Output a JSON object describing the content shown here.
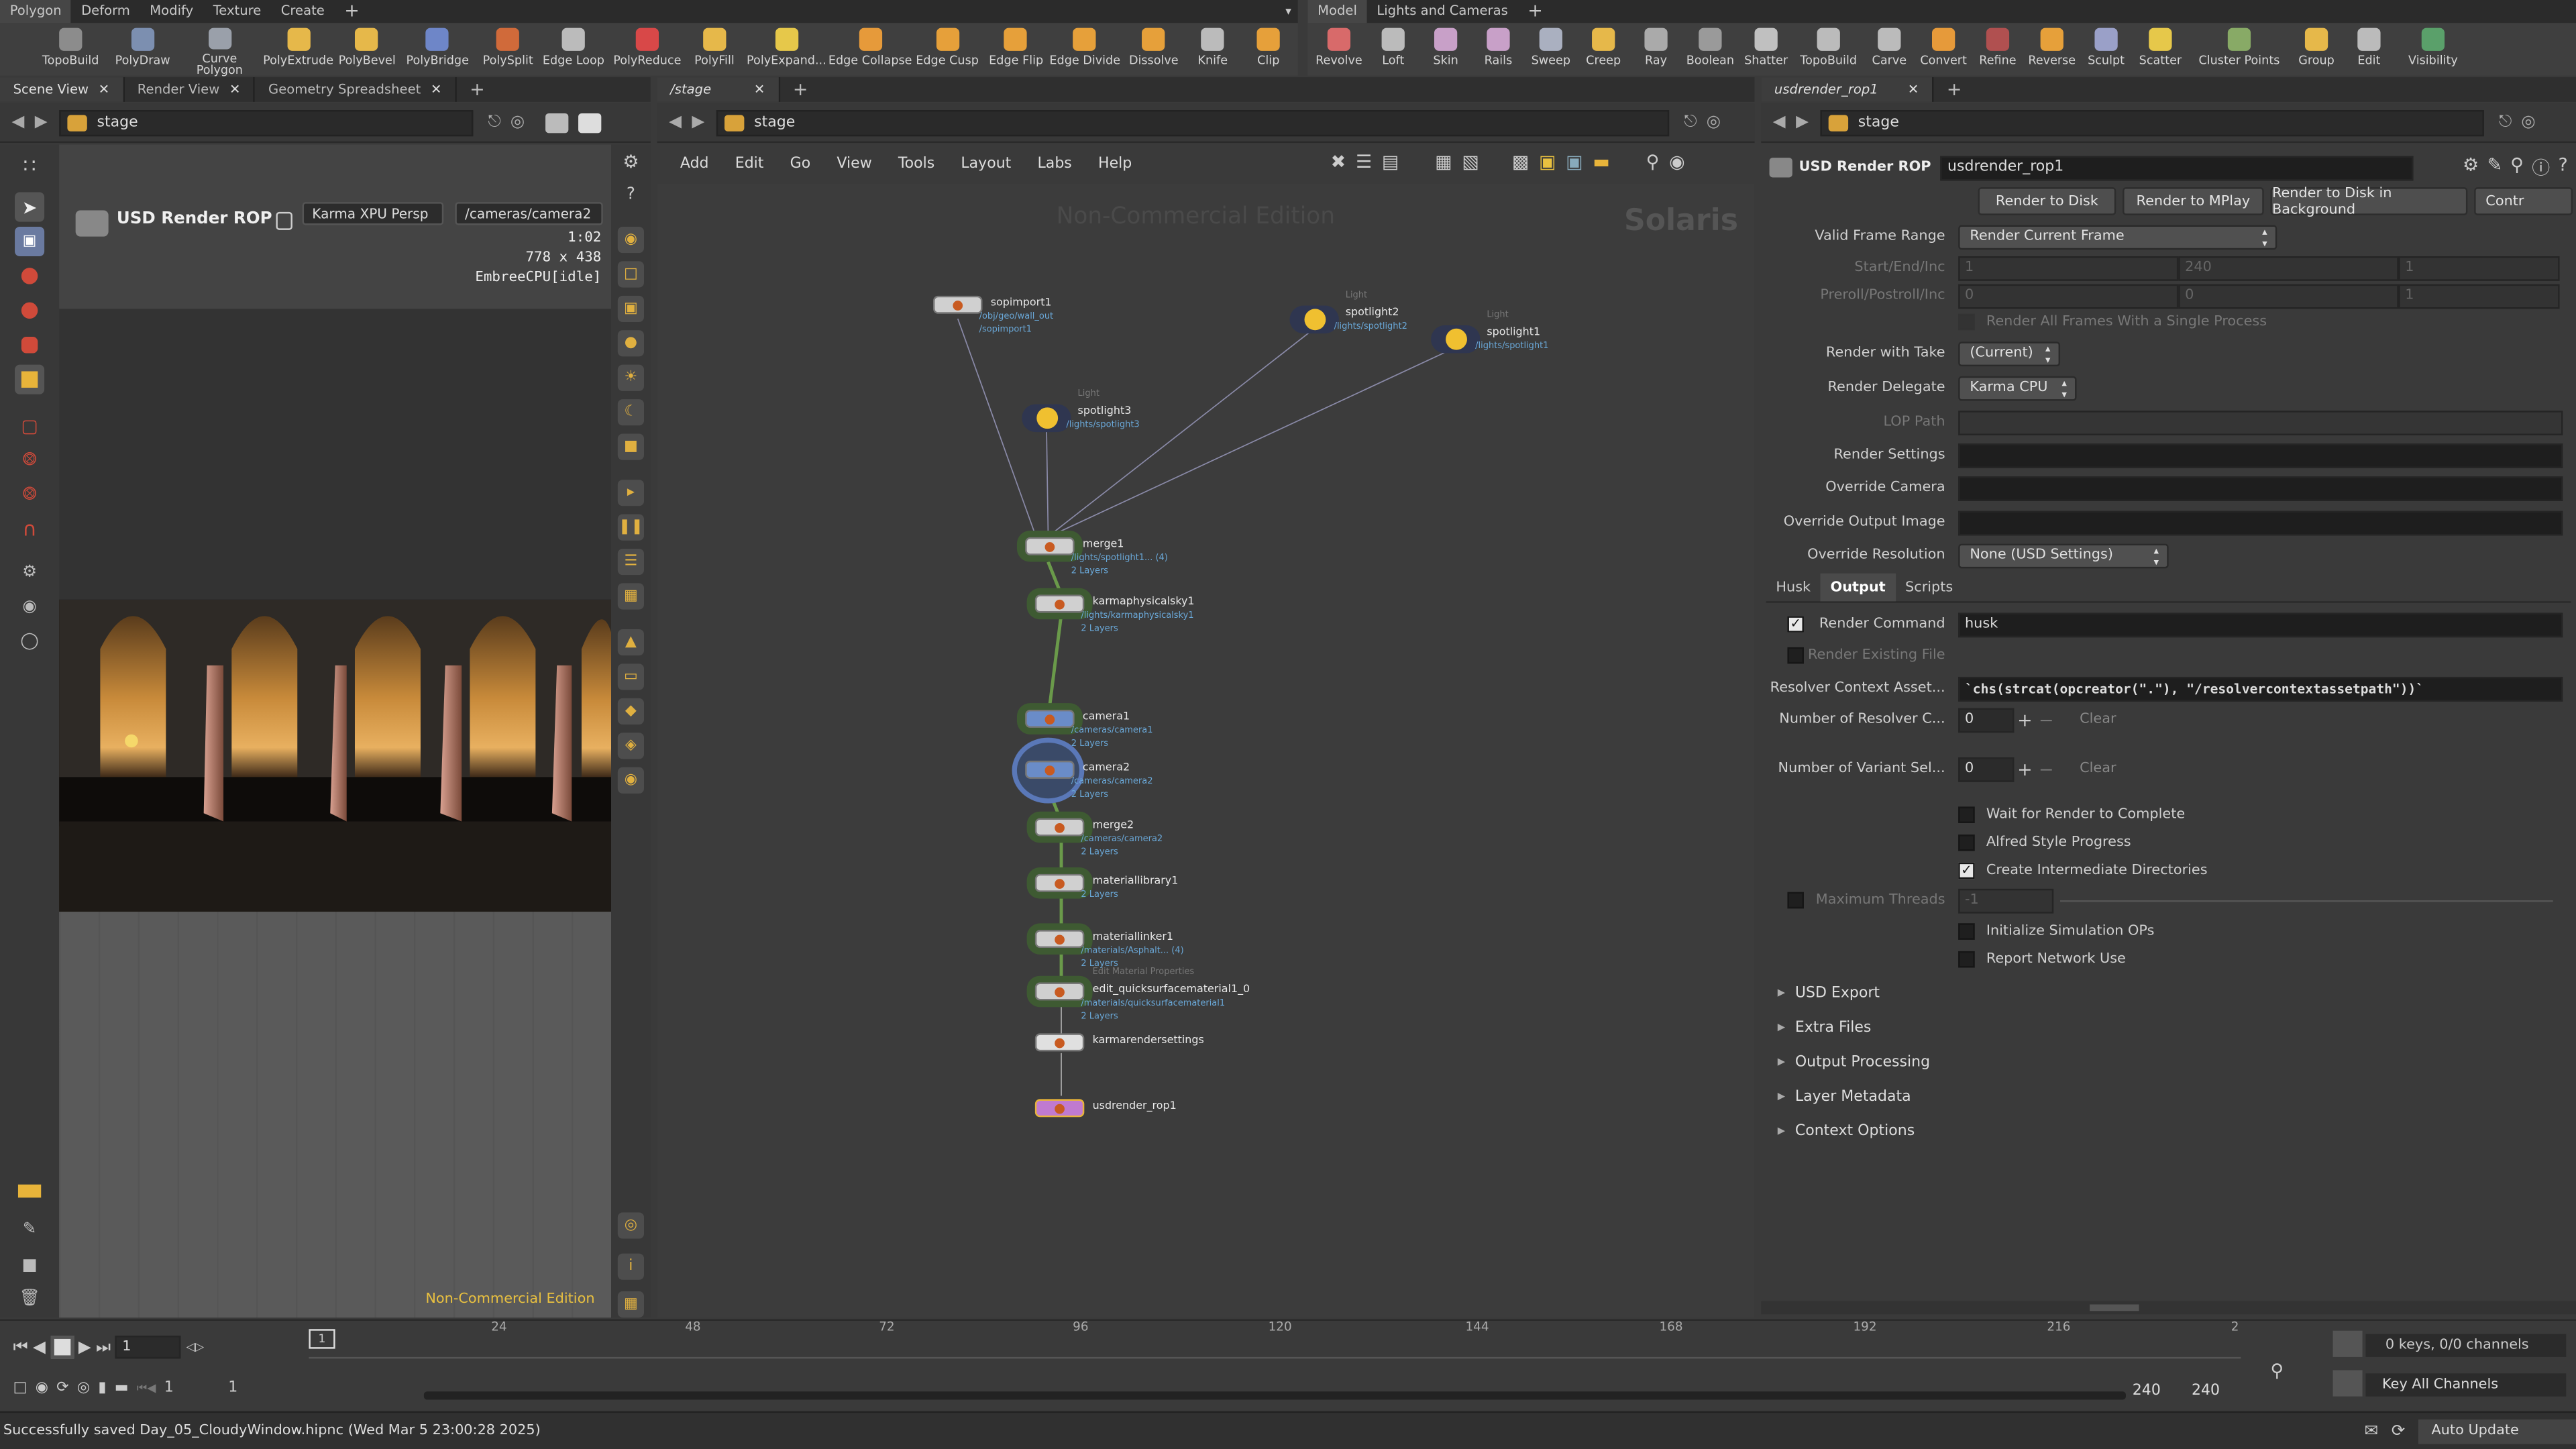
{
  "top_left_tabs": [
    "Polygon",
    "Deform",
    "Modify",
    "Texture",
    "Create"
  ],
  "top_right_tabs": [
    "Model",
    "Lights and Cameras"
  ],
  "shelf_left": [
    {
      "label": "TopoBuild",
      "color": "#8c8c8c"
    },
    {
      "label": "PolyDraw",
      "color": "#7c8fb0"
    },
    {
      "label": "Curve\nPolygon",
      "color": "#9aa0aa"
    },
    {
      "label": "PolyExtrude",
      "color": "#e6b84a"
    },
    {
      "label": "PolyBevel",
      "color": "#e6b84a"
    },
    {
      "label": "PolyBridge",
      "color": "#6e86c8"
    },
    {
      "label": "PolySplit",
      "color": "#d06a3a"
    },
    {
      "label": "Edge Loop",
      "color": "#bbbbbb"
    },
    {
      "label": "PolyReduce",
      "color": "#d84848"
    },
    {
      "label": "PolyFill",
      "color": "#e6b84a"
    },
    {
      "label": "PolyExpand...",
      "color": "#e6c84a"
    },
    {
      "label": "Edge Collapse",
      "color": "#e69a3a"
    },
    {
      "label": "Edge Cusp",
      "color": "#e6a03a"
    },
    {
      "label": "Edge Flip",
      "color": "#e6a03a"
    },
    {
      "label": "Edge Divide",
      "color": "#e6a03a"
    },
    {
      "label": "Dissolve",
      "color": "#e6a03a"
    },
    {
      "label": "Knife",
      "color": "#bbbbbb"
    },
    {
      "label": "Clip",
      "color": "#e6a03a"
    }
  ],
  "shelf_right": [
    {
      "label": "Revolve",
      "color": "#d86a6a"
    },
    {
      "label": "Loft",
      "color": "#bbbbbb"
    },
    {
      "label": "Skin",
      "color": "#c8a0c8"
    },
    {
      "label": "Rails",
      "color": "#c8a0c8"
    },
    {
      "label": "Sweep",
      "color": "#aab0c0"
    },
    {
      "label": "Creep",
      "color": "#e6b84a"
    },
    {
      "label": "Ray",
      "color": "#aaaaaa"
    },
    {
      "label": "Boolean",
      "color": "#9a9a9a"
    },
    {
      "label": "Shatter",
      "color": "#c0c0c0"
    },
    {
      "label": "TopoBuild",
      "color": "#bbbbbb"
    },
    {
      "label": "Carve",
      "color": "#bbbbbb"
    },
    {
      "label": "Convert",
      "color": "#e69a3a"
    },
    {
      "label": "Refine",
      "color": "#b05050"
    },
    {
      "label": "Reverse",
      "color": "#e6a03a"
    },
    {
      "label": "Sculpt",
      "color": "#9aa0c8"
    },
    {
      "label": "Scatter",
      "color": "#e6c84a"
    },
    {
      "label": "Cluster Points",
      "color": "#88aa66"
    },
    {
      "label": "Group",
      "color": "#e6b84a"
    },
    {
      "label": "Edit",
      "color": "#bbbbbb"
    },
    {
      "label": "Visibility",
      "color": "#5aa06a"
    }
  ],
  "left_pane": {
    "tabs": [
      "Scene View",
      "Render View",
      "Geometry Spreadsheet"
    ],
    "path": "stage",
    "rop_title": "USD Render ROP",
    "renderer_menu": "Karma XPU  Persp",
    "camera_menu": "/cameras/camera2",
    "info_time": "1:02",
    "info_res": "778 x 438",
    "info_engine": "EmbreeCPU[idle]",
    "watermark": "Non-Commercial Edition"
  },
  "network": {
    "tab": "/stage",
    "path": "stage",
    "menus": [
      "Add",
      "Edit",
      "Go",
      "View",
      "Tools",
      "Layout",
      "Labs",
      "Help"
    ],
    "watermark": "Non-Commercial Edition",
    "context": "Solaris",
    "nodes": [
      {
        "id": "sopimport1",
        "name": "sopimport1",
        "sub": "/obj/geo/wall_out",
        "sub2": "/sopimport1",
        "tag": ""
      },
      {
        "id": "spotlight3",
        "name": "spotlight3",
        "sub": "/lights/spotlight3",
        "sub2": "",
        "tag": "Light"
      },
      {
        "id": "spotlight2",
        "name": "spotlight2",
        "sub": "/lights/spotlight2",
        "sub2": "",
        "tag": "Light"
      },
      {
        "id": "spotlight1",
        "name": "spotlight1",
        "sub": "/lights/spotlight1",
        "sub2": "",
        "tag": "Light"
      },
      {
        "id": "merge1",
        "name": "merge1",
        "sub": "/lights/spotlight1... (4)",
        "sub2": "2 Layers",
        "tag": ""
      },
      {
        "id": "karmaphysicalsky1",
        "name": "karmaphysicalsky1",
        "sub": "/lights/karmaphysicalsky1",
        "sub2": "2 Layers",
        "tag": ""
      },
      {
        "id": "camera1",
        "name": "camera1",
        "sub": "/cameras/camera1",
        "sub2": "2 Layers",
        "tag": ""
      },
      {
        "id": "camera2",
        "name": "camera2",
        "sub": "/cameras/camera2",
        "sub2": "2 Layers",
        "tag": ""
      },
      {
        "id": "merge2",
        "name": "merge2",
        "sub": "/cameras/camera2",
        "sub2": "2 Layers",
        "tag": ""
      },
      {
        "id": "materiallibrary1",
        "name": "materiallibrary1",
        "sub": "",
        "sub2": "2 Layers",
        "tag": ""
      },
      {
        "id": "materiallinker1",
        "name": "materiallinker1",
        "sub": "/materials/Asphalt... (4)",
        "sub2": "2 Layers",
        "tag": ""
      },
      {
        "id": "edit_qsm",
        "name": "edit_quicksurfacematerial1_0",
        "sub": "/materials/quicksurfacematerial1",
        "sub2": "2 Layers",
        "tag": "Edit Material Properties"
      },
      {
        "id": "karmarendersettings",
        "name": "karmarendersettings",
        "sub": "",
        "sub2": "",
        "tag": ""
      },
      {
        "id": "usdrender_rop1",
        "name": "usdrender_rop1",
        "sub": "",
        "sub2": "",
        "tag": ""
      }
    ]
  },
  "params": {
    "tab": "usdrender_rop1",
    "path": "stage",
    "node_type": "USD Render ROP",
    "node_name": "usdrender_rop1",
    "buttons": [
      "Render to Disk",
      "Render to MPlay",
      "Render to Disk in Background",
      "Contr"
    ],
    "valid_frame_range_label": "Valid Frame Range",
    "valid_frame_range": "Render Current Frame",
    "start_end_inc_label": "Start/End/Inc",
    "start_end_inc": [
      "1",
      "240",
      "1"
    ],
    "preroll_label": "Preroll/Postroll/Inc",
    "preroll": [
      "0",
      "0",
      "1"
    ],
    "render_all_frames": "Render All Frames With a Single Process",
    "render_with_take_label": "Render with Take",
    "render_with_take": "(Current)",
    "render_delegate_label": "Render Delegate",
    "render_delegate": "Karma CPU",
    "lop_path_label": "LOP Path",
    "render_settings_label": "Render Settings",
    "override_camera_label": "Override Camera",
    "override_output_label": "Override Output Image",
    "override_res_label": "Override Resolution",
    "override_res": "None (USD Settings)",
    "subtabs": [
      "Husk",
      "Output",
      "Scripts"
    ],
    "render_command_label": "Render Command",
    "render_command": "husk",
    "render_existing": "Render Existing File",
    "resolver_label": "Resolver Context Asset...",
    "resolver_value": "`chs(strcat(opcreator(\".\"), \"/resolvercontextassetpath\"))`",
    "num_resolver_label": "Number of Resolver C...",
    "num_resolver": "0",
    "num_variant_label": "Number of Variant Sel...",
    "num_variant": "0",
    "clear": "Clear",
    "wait_render": "Wait for Render to Complete",
    "alfred": "Alfred Style Progress",
    "create_dirs": "Create Intermediate Directories",
    "max_threads_label": "Maximum Threads",
    "max_threads": "-1",
    "init_sim": "Initialize Simulation OPs",
    "report_net": "Report Network Use",
    "folders": [
      "USD Export",
      "Extra Files",
      "Output Processing",
      "Layer Metadata",
      "Context Options"
    ]
  },
  "timeline": {
    "frame": "1",
    "ticks": [
      "24",
      "48",
      "72",
      "96",
      "120",
      "144",
      "168",
      "192",
      "216",
      "2"
    ],
    "start": "1",
    "start2": "1",
    "end": "240",
    "end2": "240",
    "keys": "0 keys, 0/0 channels",
    "key_all": "Key All Channels"
  },
  "status": {
    "message": "Successfully saved Day_05_CloudyWindow.hipnc (Wed Mar  5 23:00:28 2025)",
    "auto_update": "Auto Update"
  },
  "colors": {
    "accent": "#e8b43a",
    "node_green": "#4a7a3a",
    "rop": "#c07ad0"
  }
}
